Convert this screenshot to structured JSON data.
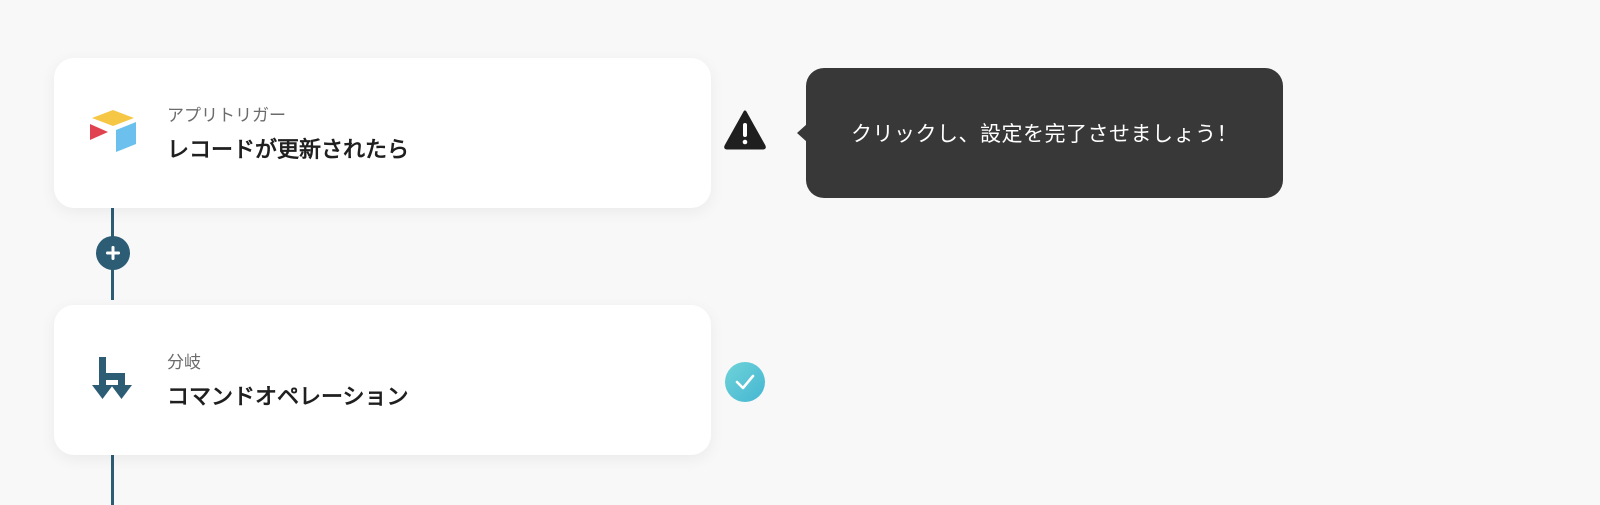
{
  "flow": {
    "steps": [
      {
        "subtitle": "アプリトリガー",
        "title": "レコードが更新されたら",
        "icon": "airtable-logo-icon",
        "status": "warning"
      },
      {
        "subtitle": "分岐",
        "title": "コマンドオペレーション",
        "icon": "branch-arrows-icon",
        "status": "complete"
      }
    ],
    "add_step_icon": "plus-icon"
  },
  "tooltip": {
    "text": "クリックし、設定を完了させましょう！"
  },
  "colors": {
    "background": "#f8f8f8",
    "connector": "#2c5d75",
    "tooltip_bg": "#383838",
    "check_badge": "#52c2d5",
    "warning": "#1f1f1f",
    "airtable_yellow": "#f6c744",
    "airtable_red": "#e0434f",
    "airtable_blue": "#6cc0ee"
  }
}
